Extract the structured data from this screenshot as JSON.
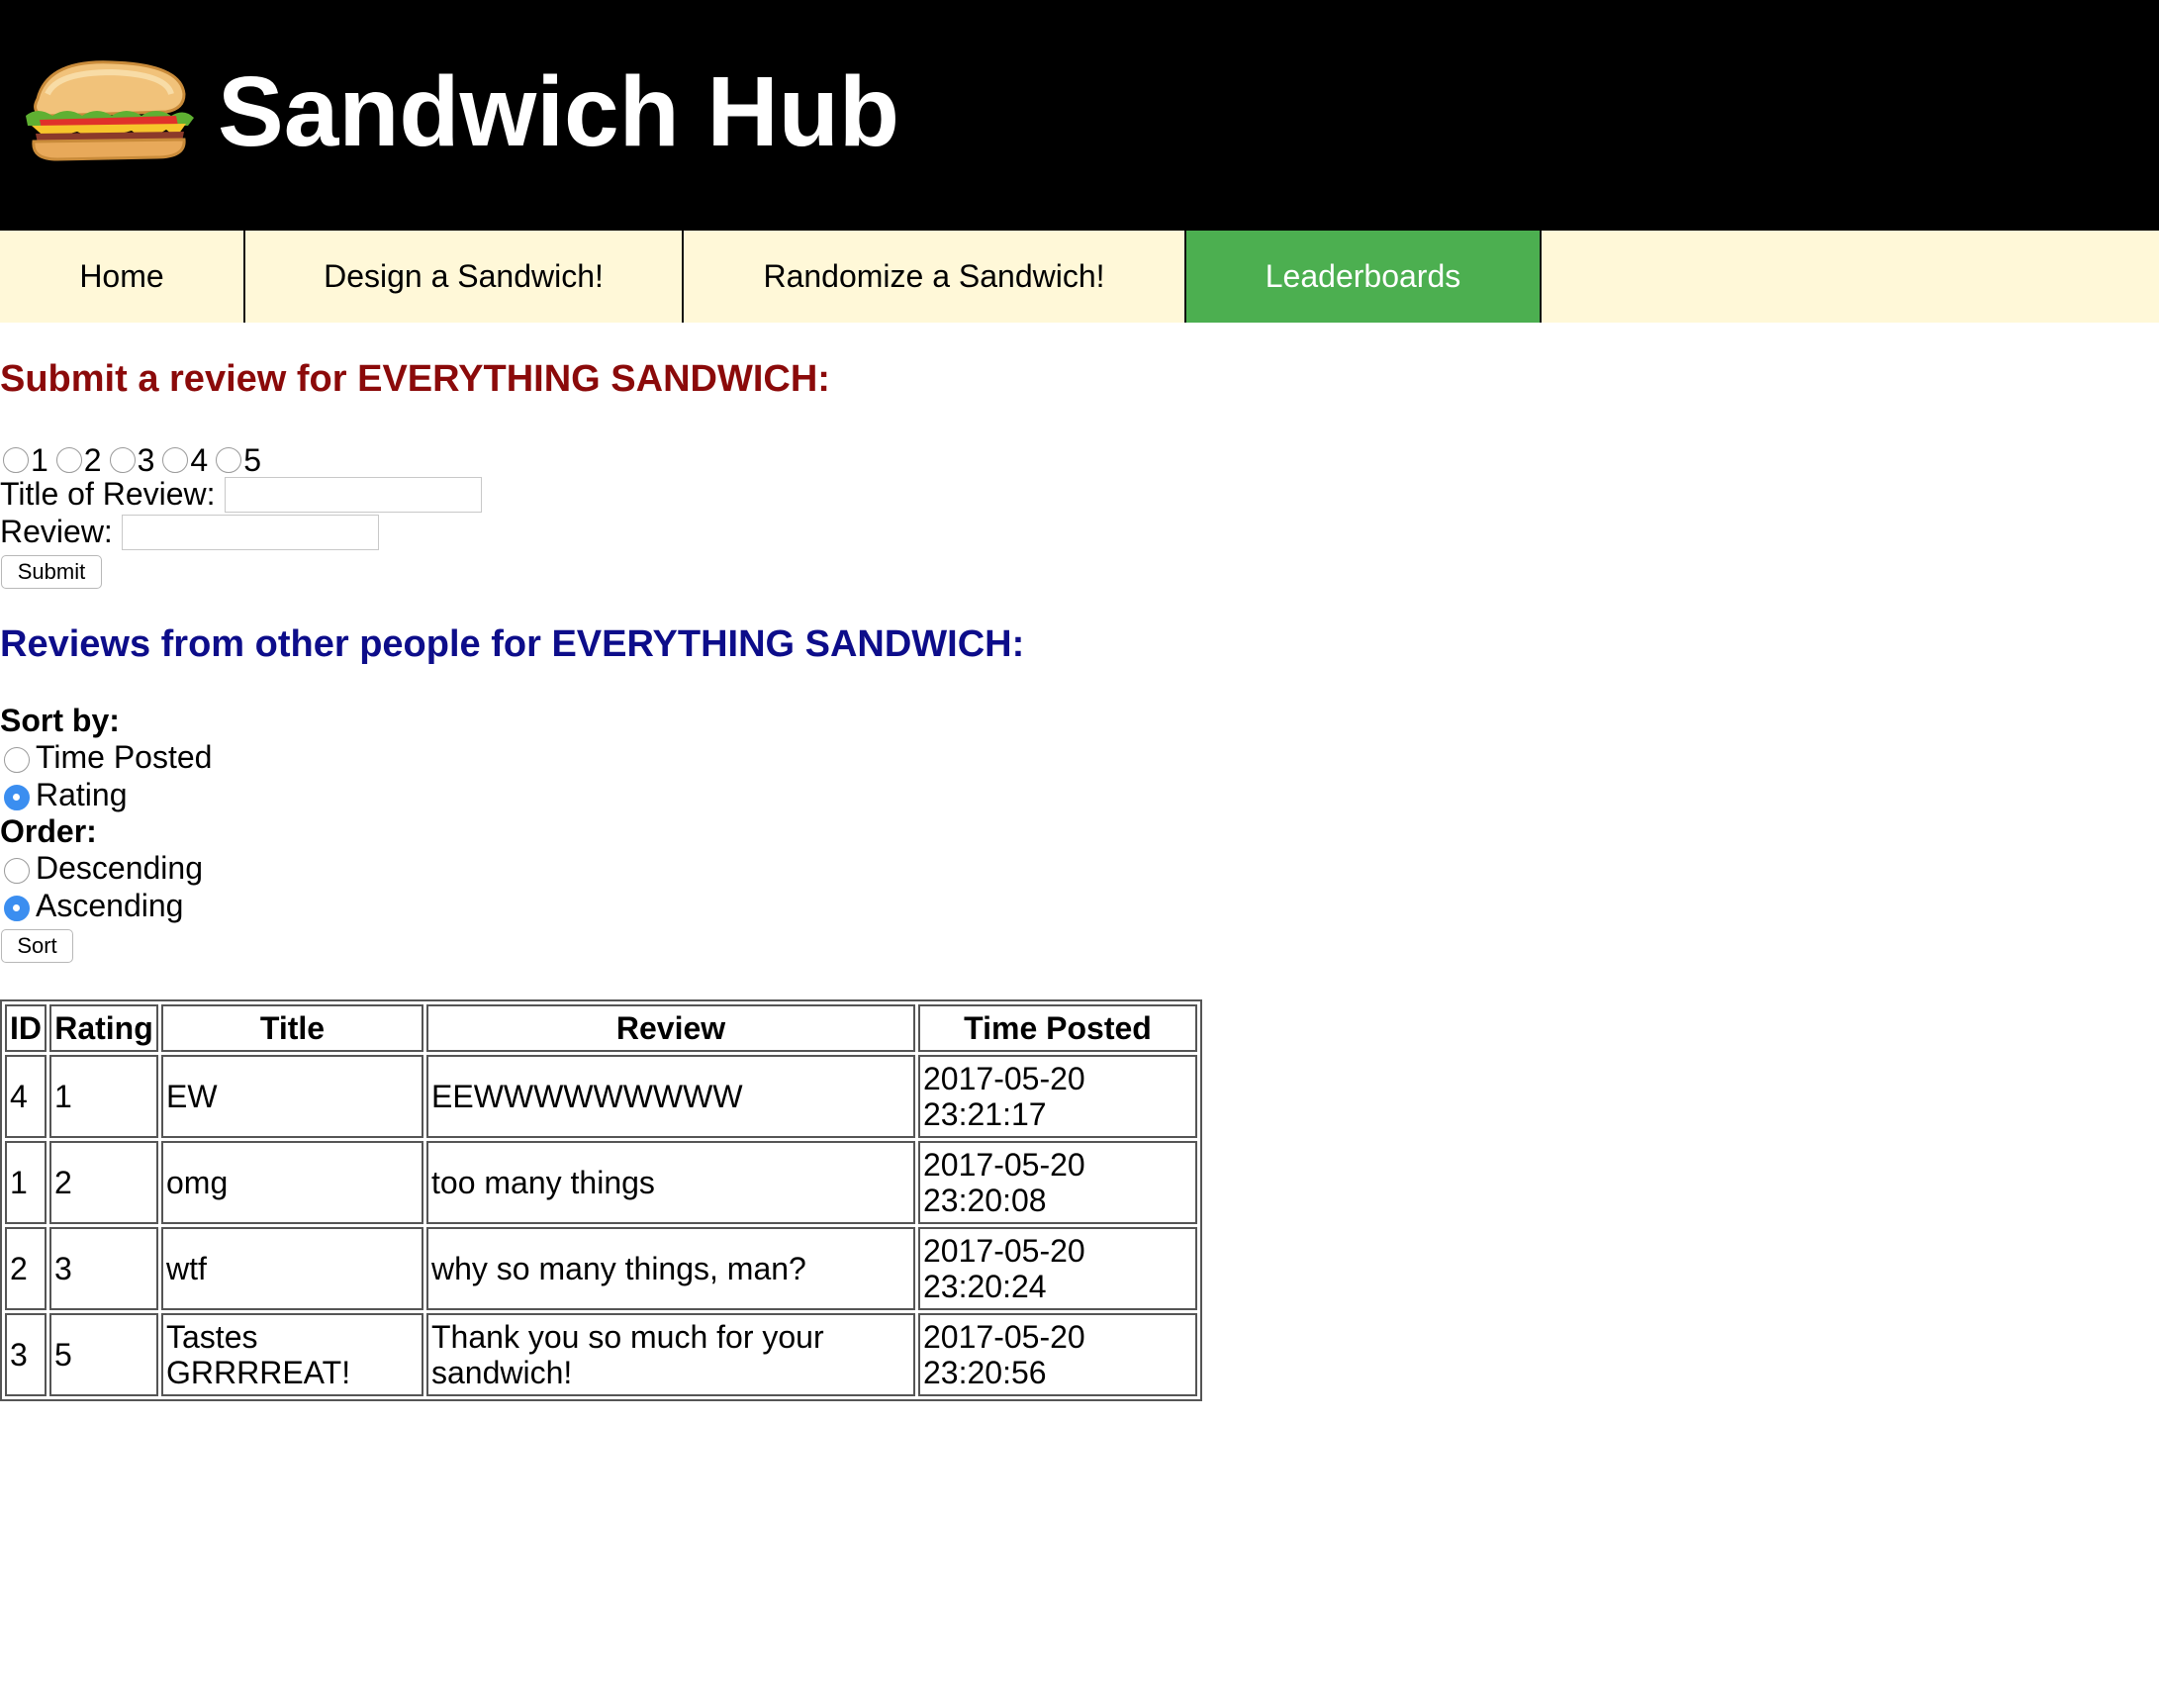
{
  "header": {
    "site_title": "Sandwich Hub",
    "logo_icon": "sandwich-icon"
  },
  "nav": {
    "items": [
      {
        "label": "Home",
        "active": false
      },
      {
        "label": "Design a Sandwich!",
        "active": false
      },
      {
        "label": "Randomize a Sandwich!",
        "active": false
      },
      {
        "label": "Leaderboards",
        "active": true
      }
    ],
    "active_color": "#4caf50",
    "background_color": "#fff8d8"
  },
  "submit_form": {
    "heading": "Submit a review for EVERYTHING SANDWICH:",
    "heading_color": "#8b0a0a",
    "rating_options": [
      "1",
      "2",
      "3",
      "4",
      "5"
    ],
    "title_label": "Title of Review:",
    "title_value": "",
    "review_label": "Review:",
    "review_value": "",
    "submit_label": "Submit"
  },
  "reviews_section": {
    "heading": "Reviews from other people for EVERYTHING SANDWICH:",
    "heading_color": "#0d0d8a",
    "sort_by_label": "Sort by:",
    "sort_options": [
      {
        "label": "Time Posted",
        "checked": false
      },
      {
        "label": "Rating",
        "checked": true
      }
    ],
    "order_label": "Order:",
    "order_options": [
      {
        "label": "Descending",
        "checked": false
      },
      {
        "label": "Ascending",
        "checked": true
      }
    ],
    "sort_button_label": "Sort"
  },
  "table": {
    "columns": [
      "ID",
      "Rating",
      "Title",
      "Review",
      "Time Posted"
    ],
    "rows": [
      {
        "id": "4",
        "rating": "1",
        "title": "EW",
        "review": "EEWWWWWWWWW",
        "time_date": "2017-05-20",
        "time_clock": "23:21:17"
      },
      {
        "id": "1",
        "rating": "2",
        "title": "omg",
        "review": "too many things",
        "time_date": "2017-05-20",
        "time_clock": "23:20:08"
      },
      {
        "id": "2",
        "rating": "3",
        "title": "wtf",
        "review": "why so many things, man?",
        "time_date": "2017-05-20",
        "time_clock": "23:20:24"
      },
      {
        "id": "3",
        "rating": "5",
        "title": "Tastes GRRRREAT!",
        "review": "Thank you so much for your sandwich!",
        "time_date": "2017-05-20",
        "time_clock": "23:20:56"
      }
    ]
  }
}
